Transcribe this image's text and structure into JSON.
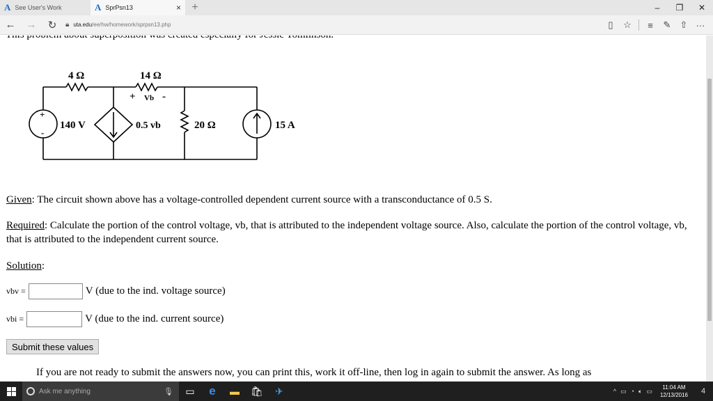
{
  "tabs": [
    {
      "title": "See User's Work",
      "icon": "acrobat-logo-icon"
    },
    {
      "title": "SprPsn13",
      "icon": "acrobat-logo-icon",
      "active": true
    }
  ],
  "address": {
    "domain": "uta.edu",
    "path": "/ee/hw/homework/sprpsn13.php"
  },
  "page": {
    "cut_intro": "This problem about superposition was created especially for Jessie Tomlinson.",
    "circuit": {
      "r1": "4 Ω",
      "r2": "14 Ω",
      "vb_plus": "+",
      "vb_label": "Vb",
      "vb_minus": "-",
      "source_plus": "+",
      "source_minus": "-",
      "voltage_source": "140 V",
      "dependent_source": "0.5 vb",
      "r3": "20 Ω",
      "current_source": "15 A"
    },
    "given_label": "Given",
    "given_text": ": The circuit shown above has a voltage-controlled dependent current source with a transconductance of 0.5 S.",
    "required_label": "Required",
    "required_text": ": Calculate the portion of the control voltage, vb, that is attributed to the independent voltage source. Also, calculate the portion of the control voltage, vb, that is attributed to the independent current source.",
    "solution_label": "Solution",
    "rows": [
      {
        "var": "vbv =",
        "value": "",
        "suffix": "V (due to the ind. voltage source)"
      },
      {
        "var": "vbi =",
        "value": "",
        "suffix": "V (due to the ind. current source)"
      }
    ],
    "submit_label": "Submit these values",
    "footer_text": "If you are not ready to submit the answers now, you can print this, work it off-line, then log in again to submit the answer. As long as"
  },
  "taskbar": {
    "search_placeholder": "Ask me anything",
    "time": "11:04 AM",
    "date": "12/13/2016",
    "notifications": "4"
  }
}
